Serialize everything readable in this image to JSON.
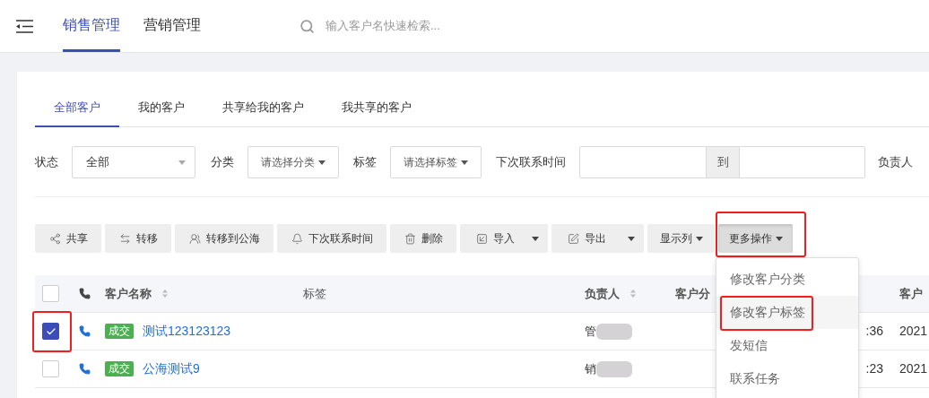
{
  "header": {
    "nav": [
      {
        "label": "销售管理",
        "selected": true
      },
      {
        "label": "营销管理",
        "selected": false
      }
    ],
    "search": {
      "placeholder": "输入客户名快速检索..."
    }
  },
  "tabs": [
    {
      "label": "全部客户",
      "selected": true
    },
    {
      "label": "我的客户",
      "selected": false
    },
    {
      "label": "共享给我的客户",
      "selected": false
    },
    {
      "label": "我共享的客户",
      "selected": false
    }
  ],
  "filters": [
    {
      "kind": "select",
      "label": "状态",
      "value": "全部"
    },
    {
      "kind": "dropdown",
      "label": "分类",
      "value": "请选择分类"
    },
    {
      "kind": "dropdown",
      "label": "标签",
      "value": "请选择标签"
    },
    {
      "kind": "range",
      "label": "下次联系时间",
      "separator": "到"
    },
    {
      "kind": "label",
      "label": "负责人"
    }
  ],
  "toolbar": [
    {
      "kind": "plain",
      "label": "共享",
      "marked": false,
      "expanded": false
    },
    {
      "kind": "plain",
      "label": "转移",
      "marked": false,
      "expanded": false
    },
    {
      "kind": "plain",
      "label": "转移到公海",
      "marked": false,
      "expanded": false
    },
    {
      "kind": "plain",
      "label": "下次联系时间",
      "marked": false,
      "expanded": false
    },
    {
      "kind": "plain",
      "label": "删除",
      "marked": false,
      "expanded": false
    },
    {
      "kind": "split",
      "label": "导入",
      "marked": false,
      "expanded": false
    },
    {
      "kind": "split",
      "label": "导出",
      "marked": false,
      "expanded": false
    },
    {
      "kind": "dropdown",
      "label": "显示列",
      "marked": false,
      "expanded": false
    },
    {
      "kind": "dropdown",
      "label": "更多操作",
      "marked": true,
      "expanded": true,
      "menu": [
        {
          "label": "修改客户分类",
          "hovered": false,
          "marked": false
        },
        {
          "label": "修改客户标签",
          "hovered": true,
          "marked": true
        },
        {
          "label": "发短信",
          "hovered": false,
          "marked": false
        },
        {
          "label": "联系任务",
          "hovered": false,
          "marked": false
        }
      ]
    }
  ],
  "table": {
    "all_checked": false,
    "columns": {
      "name": "客户名称",
      "tags": "标签",
      "owner": "负责人",
      "category": "客户分",
      "column_7": "客户"
    },
    "rows": [
      {
        "checked": true,
        "marked": true,
        "status": "成交",
        "name": "测试123123123",
        "owner": "管",
        "redacted": true,
        "time": ":36",
        "column_7": "2021"
      },
      {
        "checked": false,
        "marked": false,
        "status": "成交",
        "name": "公海测试9",
        "owner": "销",
        "redacted": true,
        "time": ":23",
        "column_7": "2021"
      }
    ]
  }
}
